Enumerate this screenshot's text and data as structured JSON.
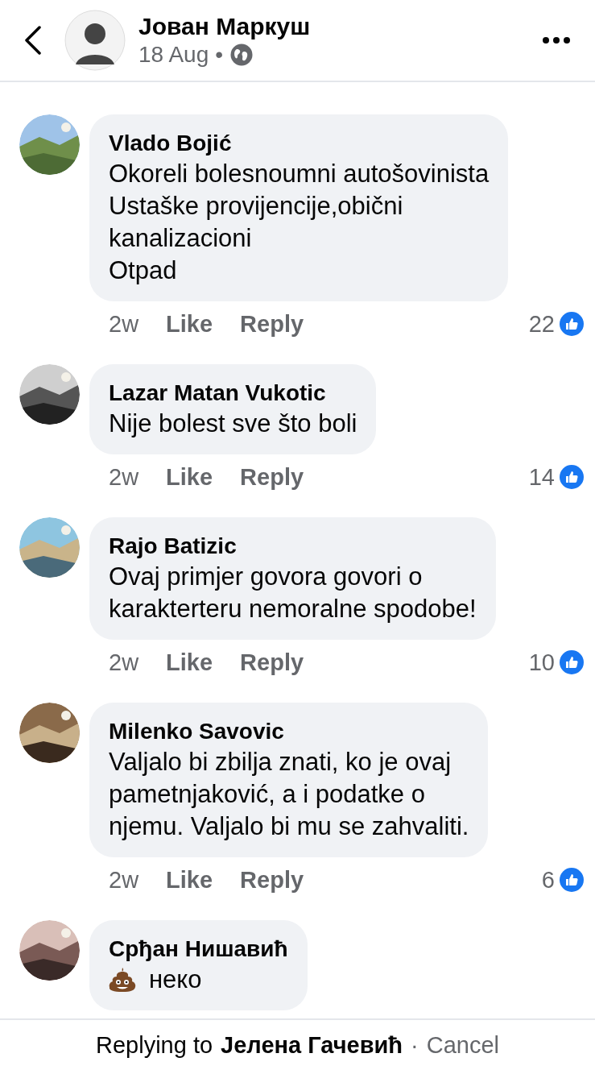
{
  "header": {
    "title": "Јован Маркуш",
    "date": "18 Aug",
    "separator": "•"
  },
  "comments": [
    {
      "author": "Vlado Bojić",
      "text": "Okoreli bolesnoumni autošovinista\nUstaške provijencije,obični\nkanalizacioni\nOtpad",
      "time": "2w",
      "like": "Like",
      "reply": "Reply",
      "reactions": "22"
    },
    {
      "author": "Lazar Matan Vukotic",
      "text": "Nije bolest sve što boli",
      "time": "2w",
      "like": "Like",
      "reply": "Reply",
      "reactions": "14"
    },
    {
      "author": "Rajo Batizic",
      "text": "Ovaj primjer govora govori o\nkarakterteru nemoralne spodobe!",
      "time": "2w",
      "like": "Like",
      "reply": "Reply",
      "reactions": "10"
    },
    {
      "author": "Milenko Savovic",
      "text": "Valjalo bi zbilja znati, ko je ovaj\npametnjaković, a i podatke o\nnjemu. Valjalo bi mu se zahvaliti.",
      "time": "2w",
      "like": "Like",
      "reply": "Reply",
      "reactions": "6"
    },
    {
      "author": "Срђан Нишавић",
      "text": "неко",
      "emoji": true
    }
  ],
  "reply_bar": {
    "prefix": "Replying to",
    "name": "Јелена Гачевић",
    "separator": "·",
    "cancel": "Cancel"
  }
}
